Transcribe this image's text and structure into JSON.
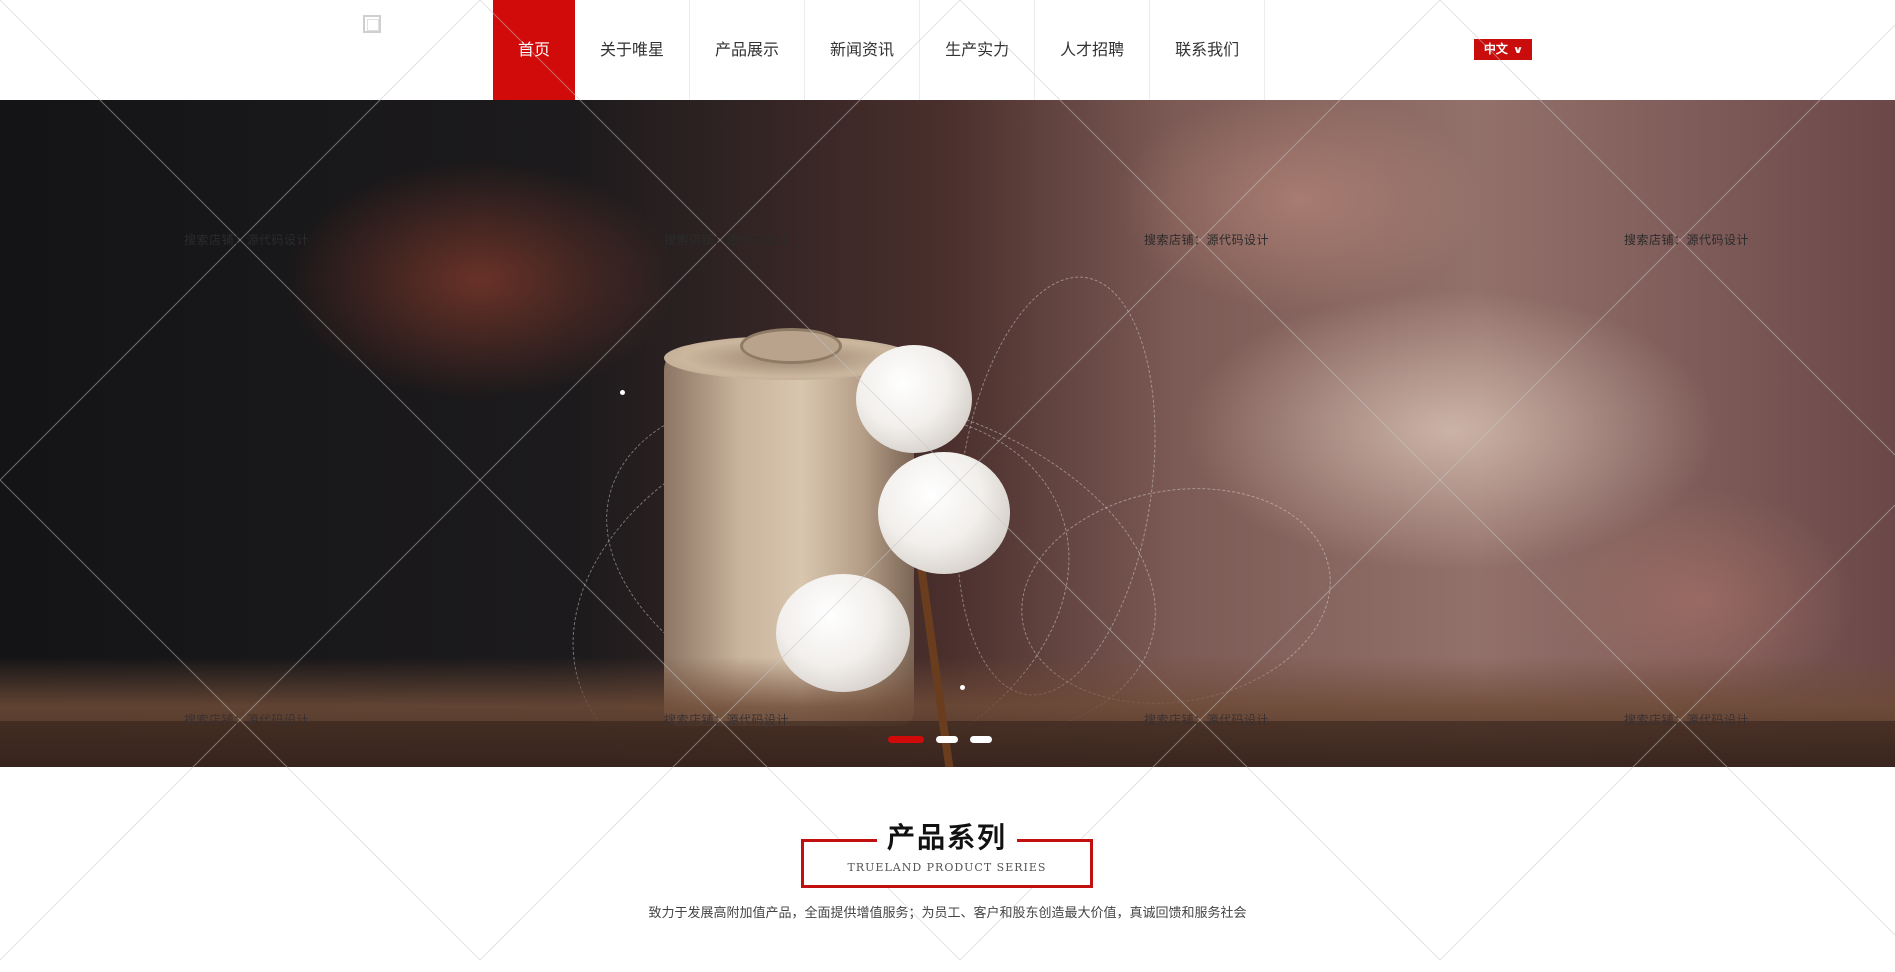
{
  "header": {
    "logo_icon": "logo-placeholder-icon",
    "nav": [
      {
        "label": "首页",
        "active": true
      },
      {
        "label": "关于唯星",
        "active": false
      },
      {
        "label": "产品展示",
        "active": false
      },
      {
        "label": "新闻资讯",
        "active": false
      },
      {
        "label": "生产实力",
        "active": false
      },
      {
        "label": "人才招聘",
        "active": false
      },
      {
        "label": "联系我们",
        "active": false
      }
    ],
    "language": {
      "label": "中文",
      "icon": "chevron-down-icon"
    }
  },
  "banner": {
    "slide_count": 3,
    "active_slide": 1
  },
  "watermark": {
    "text": "搜索店铺：源代码设计"
  },
  "section": {
    "title": "产品系列",
    "subtitle": "TRUELAND PRODUCT SERIES",
    "description": "致力于发展高附加值产品，全面提供增值服务；为员工、客户和股东创造最大价值，真诚回馈和服务社会"
  },
  "colors": {
    "accent": "#d10a0a",
    "section_border": "#c20f0f"
  }
}
